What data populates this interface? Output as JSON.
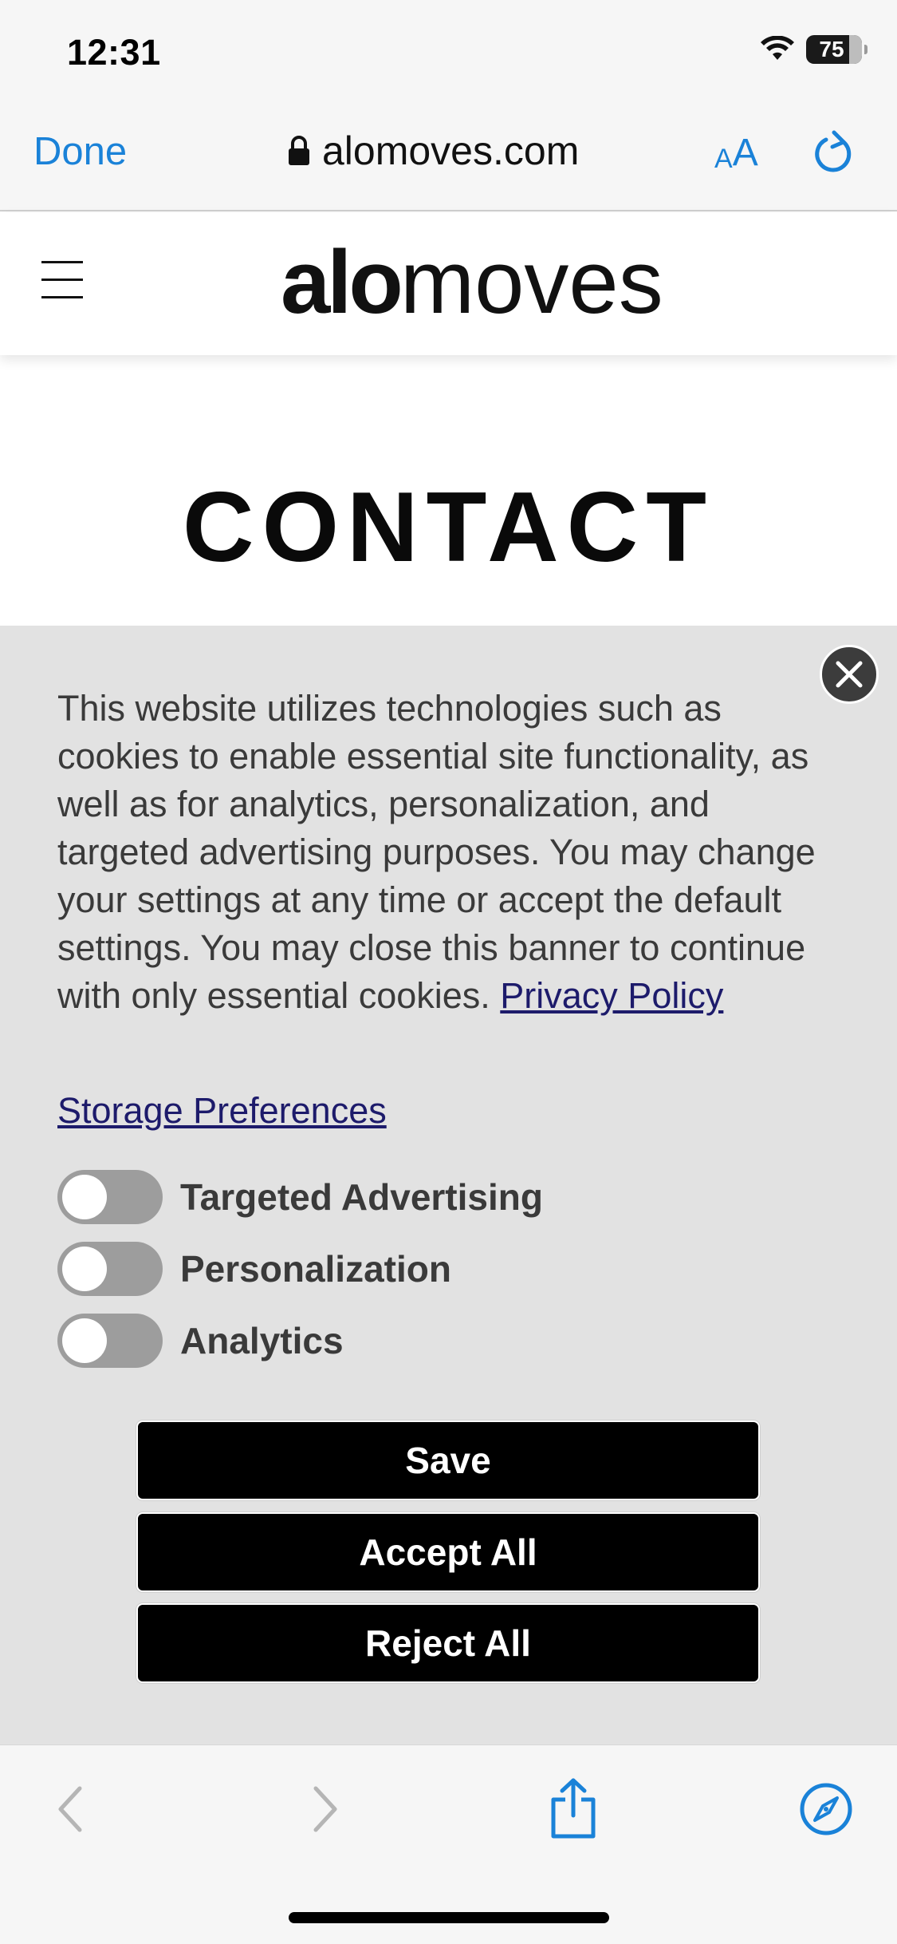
{
  "status_bar": {
    "time": "12:31",
    "battery": "75"
  },
  "browser": {
    "done_label": "Done",
    "url": "alomoves.com",
    "text_size_small": "A",
    "text_size_big": "A"
  },
  "site": {
    "logo_bold": "alo",
    "logo_light": "moves",
    "page_title": "CONTACT"
  },
  "cookie_banner": {
    "body_text": "This website utilizes technologies such as cookies to enable essential site functionality, as well as for analytics, personalization, and targeted advertising purposes. You may change your settings at any time or accept the default settings. You may close this banner to continue with only essential cookies. ",
    "privacy_policy_label": "Privacy Policy",
    "storage_preferences_label": "Storage Preferences",
    "toggles": [
      {
        "label": "Targeted Advertising",
        "on": false
      },
      {
        "label": "Personalization",
        "on": false
      },
      {
        "label": "Analytics",
        "on": false
      }
    ],
    "save_label": "Save",
    "accept_all_label": "Accept All",
    "reject_all_label": "Reject All"
  },
  "colors": {
    "accent": "#1a82d8",
    "link": "#1d1b6b",
    "banner_bg": "#e2e2e2",
    "button_bg": "#000000"
  },
  "icons": {
    "wifi": "wifi-icon",
    "lock": "lock-icon",
    "reload": "reload-icon",
    "menu": "hamburger-icon",
    "close": "close-icon",
    "back": "chevron-left-icon",
    "forward": "chevron-right-icon",
    "share": "share-icon",
    "compass": "compass-icon"
  }
}
